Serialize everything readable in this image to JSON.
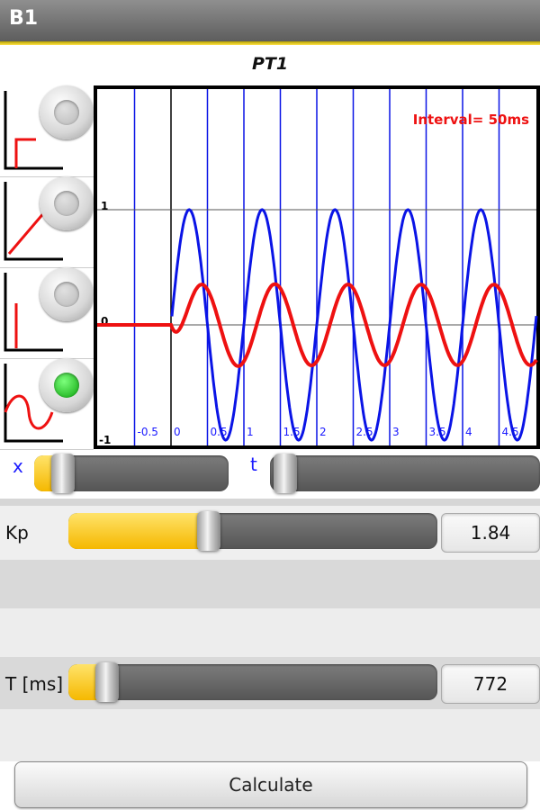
{
  "window": {
    "title": "B1"
  },
  "screen": {
    "subtitle": "PT1"
  },
  "plot": {
    "interval_label": "Interval= 50ms",
    "y_ticks": [
      "1",
      "0",
      "-1"
    ],
    "x_ticks": [
      "-0.5",
      "0",
      "0.5",
      "1",
      "1.5",
      "2",
      "2.5",
      "3",
      "3.5",
      "4",
      "4.5"
    ],
    "colors": {
      "input": "#0a14e6",
      "output": "#ee1111",
      "grid": "#0a14e6",
      "frame": "#000000"
    }
  },
  "input_modes": [
    {
      "name": "step",
      "selected": false
    },
    {
      "name": "ramp",
      "selected": false
    },
    {
      "name": "impulse",
      "selected": false
    },
    {
      "name": "sine",
      "selected": true
    }
  ],
  "controls": {
    "x_label": "x",
    "t_label": "t",
    "x_slider_value": 0.1,
    "t_slider_value": 0.0,
    "kp": {
      "label": "Kp",
      "value": "1.84",
      "slider_fraction": 0.38
    },
    "t_ms": {
      "label": "T [ms]",
      "value": "772",
      "slider_fraction": 0.08
    }
  },
  "actions": {
    "calculate_label": "Calculate"
  },
  "accent_color": "#f5b800"
}
